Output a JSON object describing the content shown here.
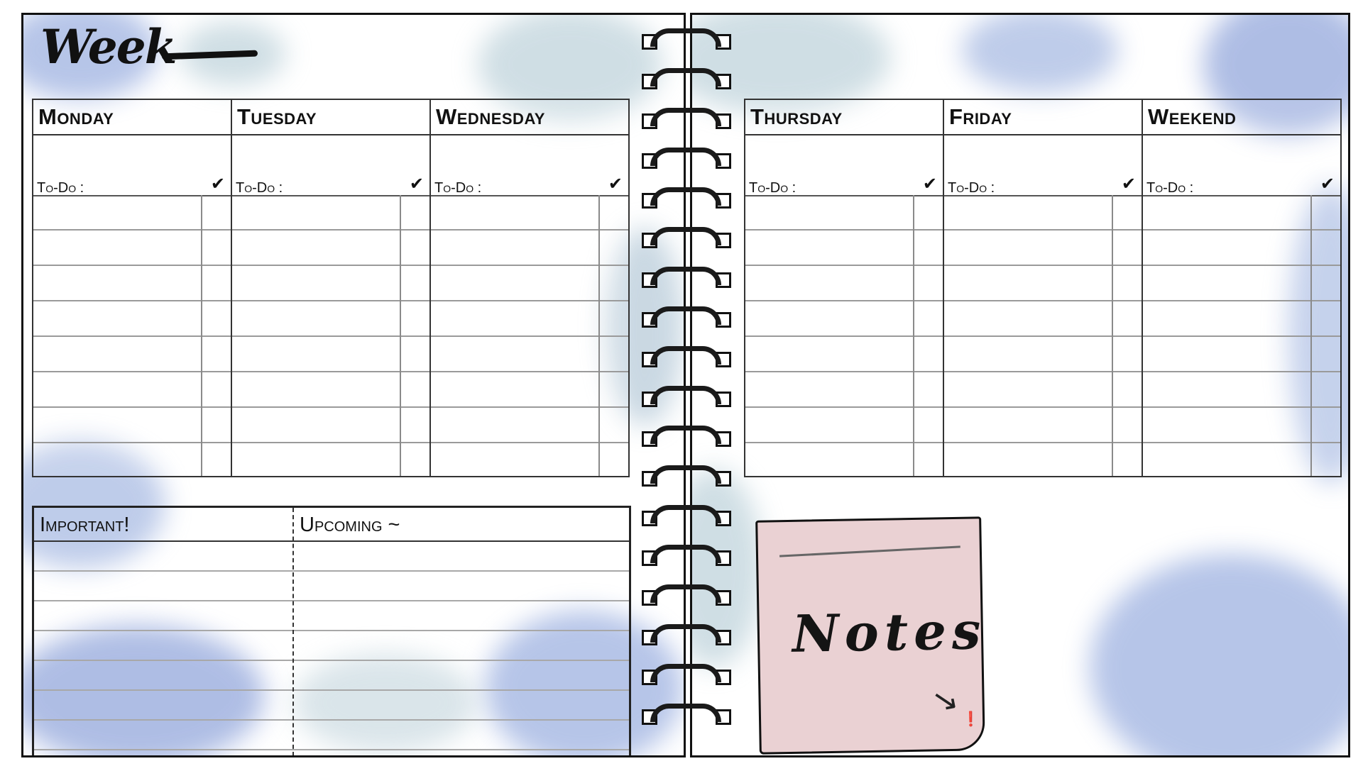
{
  "planner": {
    "title": "Week",
    "days": [
      {
        "name": "Monday",
        "todo": "To-Do :"
      },
      {
        "name": "Tuesday",
        "todo": "To-Do :"
      },
      {
        "name": "Wednesday",
        "todo": "To-Do :"
      },
      {
        "name": "Thursday",
        "todo": "To-Do :"
      },
      {
        "name": "Friday",
        "todo": "To-Do :"
      },
      {
        "name": "Weekend",
        "todo": "To-Do :"
      }
    ],
    "check_icon": "checkmark-icon",
    "important": "Important!",
    "upcoming": "Upcoming ~",
    "notes": "Notes",
    "accent": "#5b7bc9"
  }
}
